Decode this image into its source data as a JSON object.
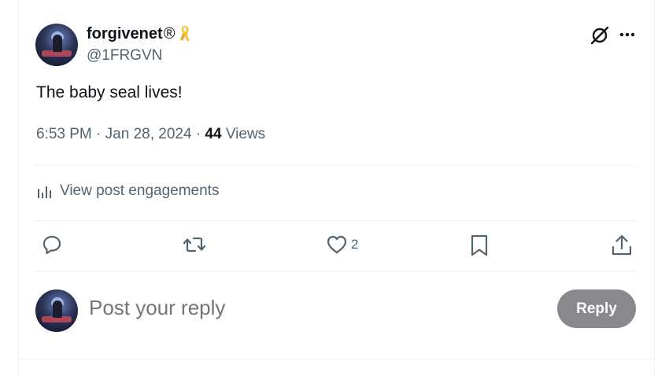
{
  "author": {
    "display_name": "forgivenet",
    "registered_mark": "®",
    "handle": "@1FRGVN",
    "avatar_icon": "avatar-pianist",
    "badge_icon": "yellow-ribbon-icon"
  },
  "post": {
    "text": "The baby seal lives!",
    "time": "6:53 PM",
    "date": "Jan 28, 2024",
    "separator": "·",
    "views_count": "44",
    "views_label": "Views"
  },
  "engagements": {
    "label": "View post engagements",
    "icon": "analytics-bars-icon"
  },
  "actions": {
    "reply_icon": "comment-icon",
    "repost_icon": "repost-icon",
    "like_icon": "heart-icon",
    "like_count": "2",
    "bookmark_icon": "bookmark-icon",
    "share_icon": "share-icon"
  },
  "header_actions": {
    "grok_icon": "grok-slash-icon",
    "more_icon": "more-dots-icon"
  },
  "composer": {
    "placeholder": "Post your reply",
    "button_label": "Reply"
  },
  "colors": {
    "text": "#0f1419",
    "secondary": "#536471",
    "divider": "#eff3f4",
    "reply_button": "#87898c",
    "ribbon": "#f5c542"
  }
}
